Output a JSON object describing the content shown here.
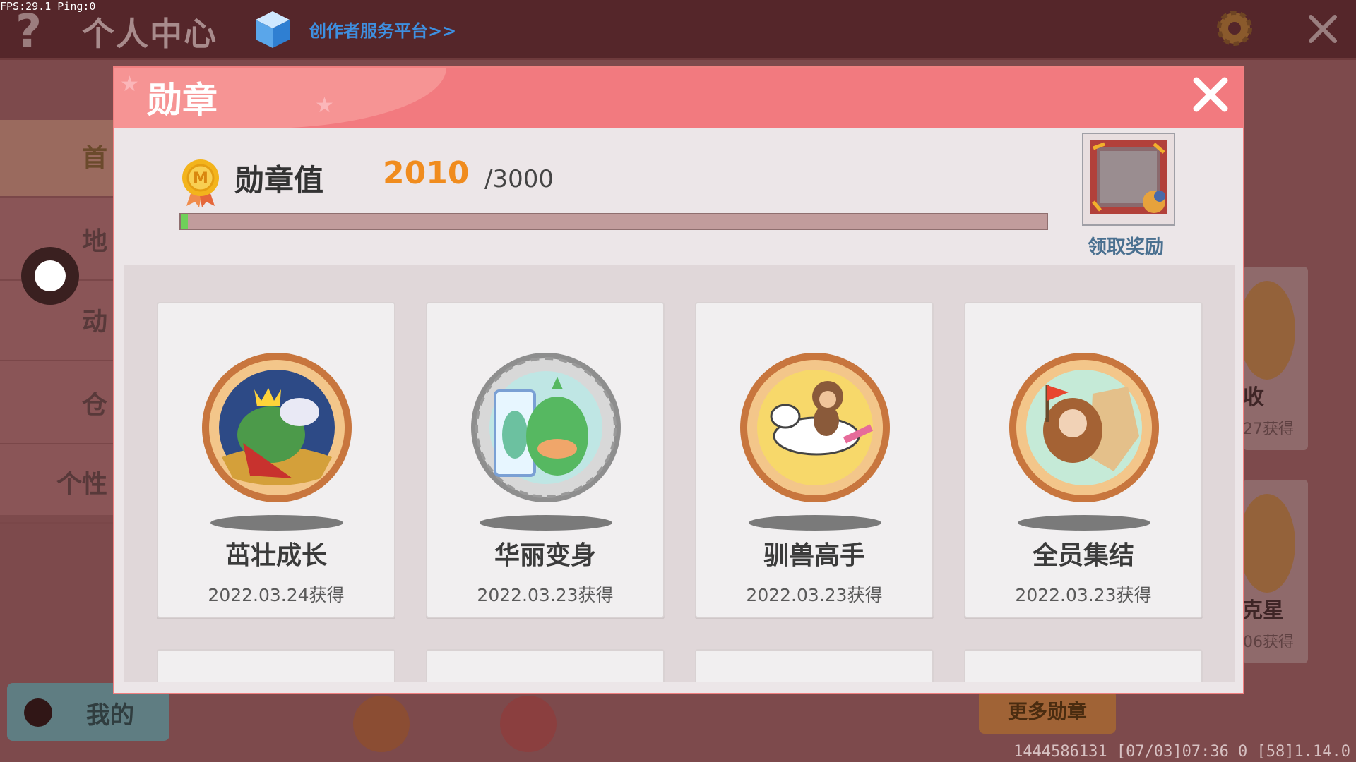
{
  "debug": {
    "fps_ping": "FPS:29.1 Ping:0"
  },
  "header": {
    "help_icon": "?",
    "title": "个人中心",
    "creator_link": "创作者服务平台>>",
    "icons": [
      "question-icon",
      "cube-icon",
      "gear-icon",
      "close-icon"
    ]
  },
  "left_nav": {
    "items": [
      {
        "label": "首"
      },
      {
        "label": "地"
      },
      {
        "label": "动"
      },
      {
        "label": "仓"
      },
      {
        "label": "个性"
      }
    ],
    "my_tab": "我的"
  },
  "right_peek": {
    "cards": [
      {
        "label": "收",
        "date": "27获得"
      },
      {
        "label": "克星",
        "date": "06获得"
      }
    ],
    "more_button": "更多勋章"
  },
  "footer": {
    "info": "1444586131   [07/03]07:36 0  [58]1.14.0"
  },
  "modal": {
    "title": "勋章",
    "medal_value_label": "勋章值",
    "current": "2010",
    "max": "/3000",
    "progress_fraction": 0.008,
    "reward_label": "领取奖励",
    "badges": [
      {
        "name": "茁壮成长",
        "date": "2022.03.24获得",
        "tier": "gold",
        "icon": "green-dino-king-icon"
      },
      {
        "name": "华丽变身",
        "date": "2022.03.23获得",
        "tier": "silver",
        "icon": "dino-mirror-icon"
      },
      {
        "name": "驯兽高手",
        "date": "2022.03.23获得",
        "tier": "gold",
        "icon": "rider-horse-icon"
      },
      {
        "name": "全员集结",
        "date": "2022.03.23获得",
        "tier": "gold",
        "icon": "group-flag-icon"
      }
    ]
  },
  "colors": {
    "accent_header": "#f27a7f",
    "value_orange": "#f08c1e",
    "progress_green": "#6fd15a",
    "link_blue": "#3e8fe0"
  }
}
